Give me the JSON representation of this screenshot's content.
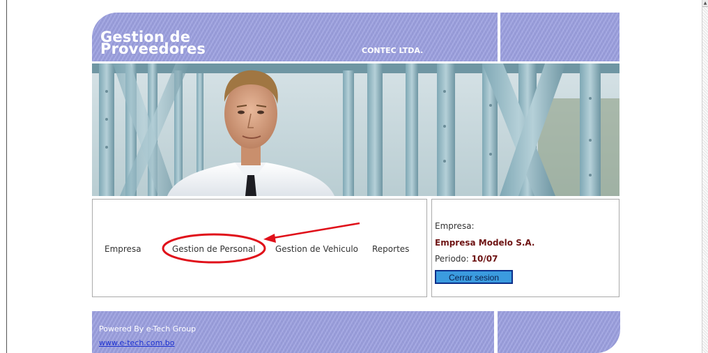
{
  "header": {
    "title_line1": "Gestion de",
    "title_line2": "Proveedores",
    "company": "CONTEC LTDA."
  },
  "nav": {
    "items": [
      {
        "label": "Empresa"
      },
      {
        "label": "Gestion de Personal"
      },
      {
        "label": "Gestion de Vehiculo"
      },
      {
        "label": "Reportes"
      }
    ],
    "highlighted_item": "Gestion de Personal",
    "annotation_color": "#e0101a"
  },
  "info": {
    "company_label": "Empresa:",
    "company_value": "Empresa Modelo S.A.",
    "period_label": "Periodo:",
    "period_value": "10/07",
    "logout_label": "Cerrar sesion"
  },
  "footer": {
    "powered_by": "Powered By e-Tech Group",
    "link": "www.e-tech.com.bo"
  },
  "colors": {
    "header_lavender": "#9b9fdf",
    "value_text": "#6e1414",
    "button_fill": "#3b9bdf",
    "link": "#1a2fd0"
  }
}
